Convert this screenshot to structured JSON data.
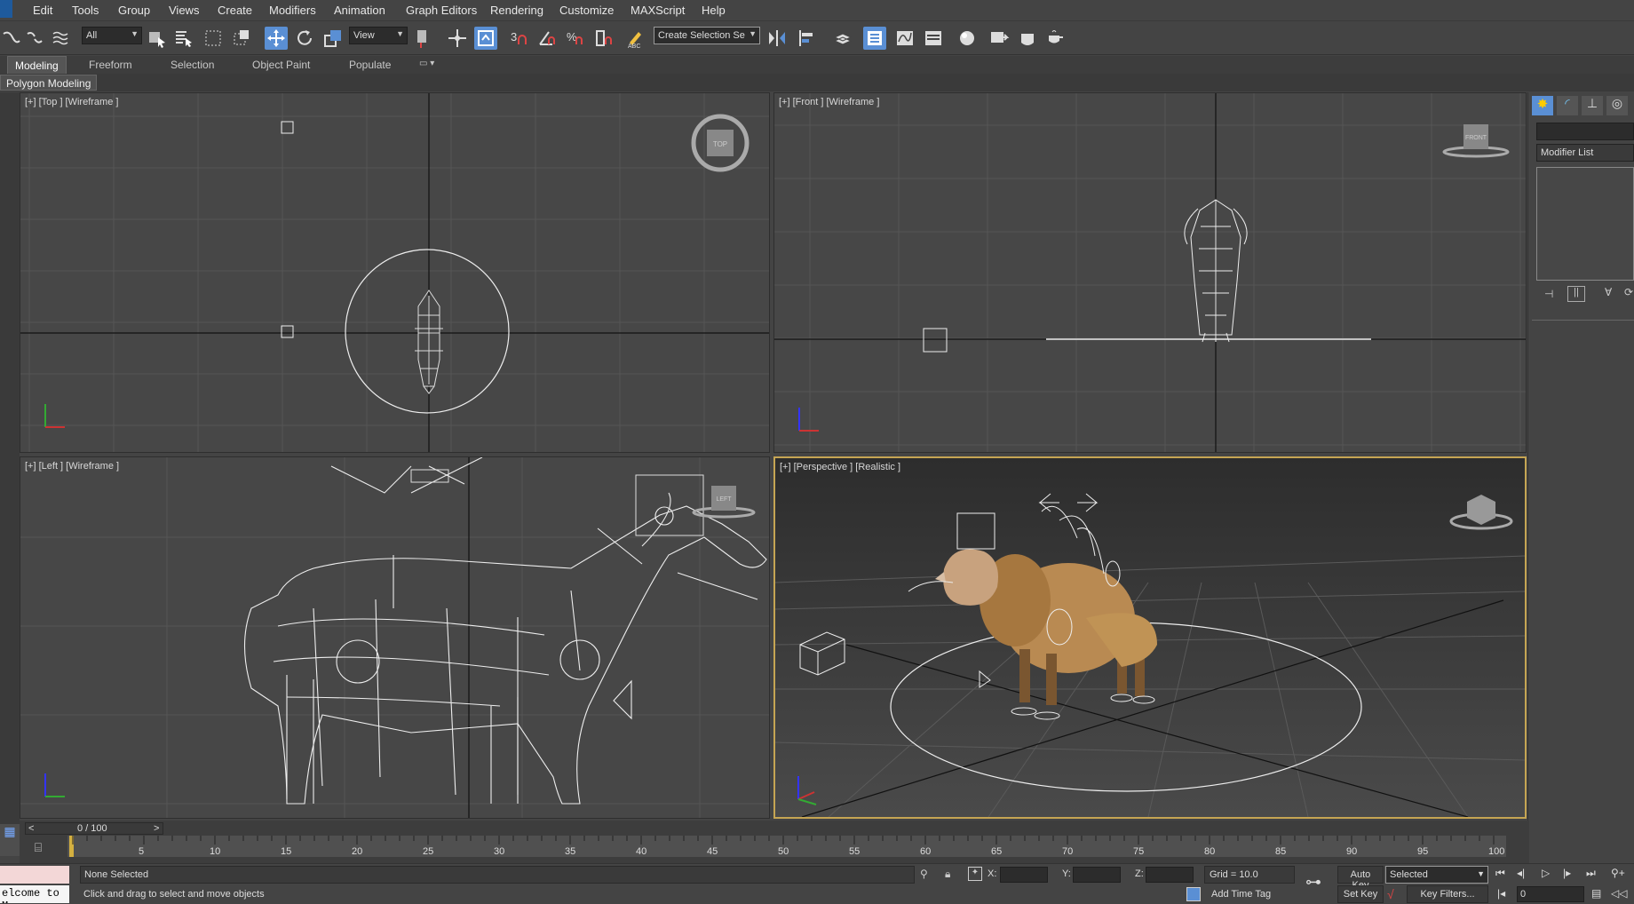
{
  "menu": [
    "Edit",
    "Tools",
    "Group",
    "Views",
    "Create",
    "Modifiers",
    "Animation",
    "Graph Editors",
    "Rendering",
    "Customize",
    "MAXScript",
    "Help"
  ],
  "toolbar": {
    "selection_filter": "All",
    "reference_coord": "View",
    "named_selection": "Create Selection Se"
  },
  "ribbon": {
    "tabs": [
      "Modeling",
      "Freeform",
      "Selection",
      "Object Paint",
      "Populate"
    ],
    "active_tab": "Modeling",
    "panel": "Polygon Modeling"
  },
  "viewports": {
    "top": "[+] [Top ] [Wireframe ]",
    "front": "[+] [Front ] [Wireframe ]",
    "left": "[+] [Left ] [Wireframe ]",
    "perspective": "[+] [Perspective ] [Realistic ]",
    "viewcube_top": "TOP",
    "viewcube_front": "FRONT",
    "viewcube_left": "LEFT"
  },
  "command_panel": {
    "modifier_list": "Modifier List"
  },
  "timeline": {
    "frame_display": "0 / 100",
    "prev": "<",
    "next": ">",
    "ticks": [
      "5",
      "10",
      "15",
      "20",
      "25",
      "30",
      "35",
      "40",
      "45",
      "50",
      "55",
      "60",
      "65",
      "70",
      "75",
      "80",
      "85",
      "90",
      "95",
      "100"
    ]
  },
  "status": {
    "selection": "None Selected",
    "prompt": "Click and drag to select and move objects",
    "maxscript": "elcome to M",
    "x_label": "X:",
    "y_label": "Y:",
    "z_label": "Z:",
    "grid": "Grid = 10.0",
    "add_time_tag": "Add Time Tag",
    "auto_key": "Auto Key",
    "set_key": "Set Key",
    "key_mode": "Selected",
    "key_filters": "Key Filters...",
    "current_frame": "0"
  },
  "colors": {
    "active_viewport_border": "#c5a553",
    "active_tool": "#5a8fd4",
    "sheep_wool": "#b98a52"
  }
}
